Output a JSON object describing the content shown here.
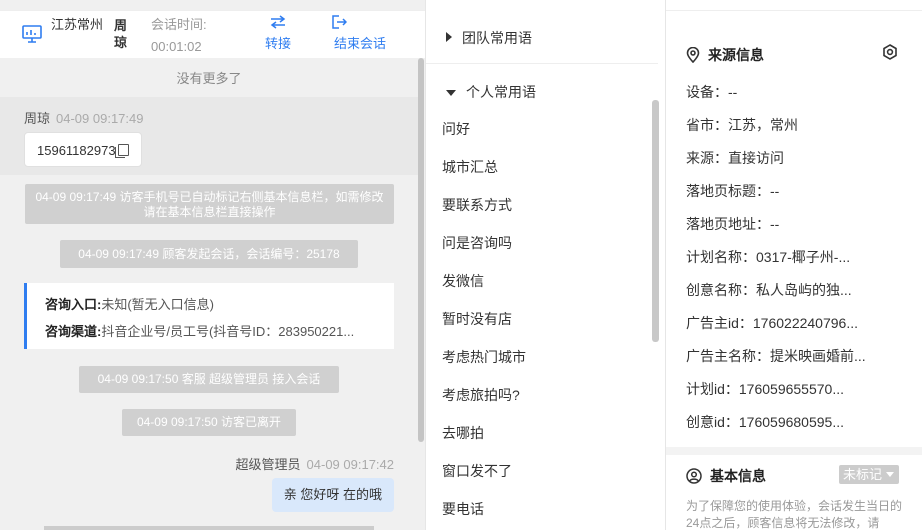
{
  "header": {
    "location": "江苏常州",
    "visitor_name": "周琼",
    "session_time_label": "会话时间:",
    "session_time_value": "00:01:02",
    "transfer_label": "转接",
    "end_label": "结束会话"
  },
  "chat": {
    "no_more": "没有更多了",
    "visitor_msg": {
      "sender": "周琼",
      "time": "04-09 09:17:49",
      "text": "15961182973"
    },
    "system1": "04-09 09:17:49 访客手机号已自动标记右侧基本信息栏，如需修改请在基本信息栏直接操作",
    "system2": "04-09 09:17:49 顾客发起会话，会话编号：25178",
    "entry_label": "咨询入口:",
    "entry_value": "未知(暂无入口信息)",
    "channel_label": "咨询渠道:",
    "channel_value": "抖音企业号/员工号(抖音号ID：283950221...",
    "system3": "04-09 09:17:50 客服 超级管理员 接入会话",
    "system4": "04-09 09:17:50 访客已离开",
    "agent_msg": {
      "sender": "超级管理员",
      "time": "04-09 09:17:42",
      "text": "亲 您好呀 在的哦"
    }
  },
  "phrases": {
    "team_group": "团队常用语",
    "personal_group": "个人常用语",
    "items": [
      "问好",
      "城市汇总",
      "要联系方式",
      "问是咨询吗",
      "发微信",
      "暂时没有店",
      "考虑热门城市",
      "考虑旅拍吗?",
      "去哪拍",
      "窗口发不了",
      "要电话"
    ]
  },
  "info": {
    "source_title": "来源信息",
    "rows": [
      "设备：--",
      "省市：江苏，常州",
      "来源：直接访问",
      "落地页标题：--",
      "落地页地址：--",
      "计划名称：0317-椰子州-...",
      "创意名称：私人岛屿的独...",
      "广告主id：176022240796...",
      "广告主名称：提米映画婚前...",
      "计划id：176059655570...",
      "创意id：176059680595..."
    ],
    "basic_title": "基本信息",
    "tag_label": "未标记",
    "note": "为了保障您的使用体验，会话发生当日的24点之后，顾客信息将无法修改，请"
  },
  "colors": {
    "accent": "#2f7df0",
    "system_bubble": "#d0d0d0",
    "agent_bubble": "#d9e8fb"
  }
}
